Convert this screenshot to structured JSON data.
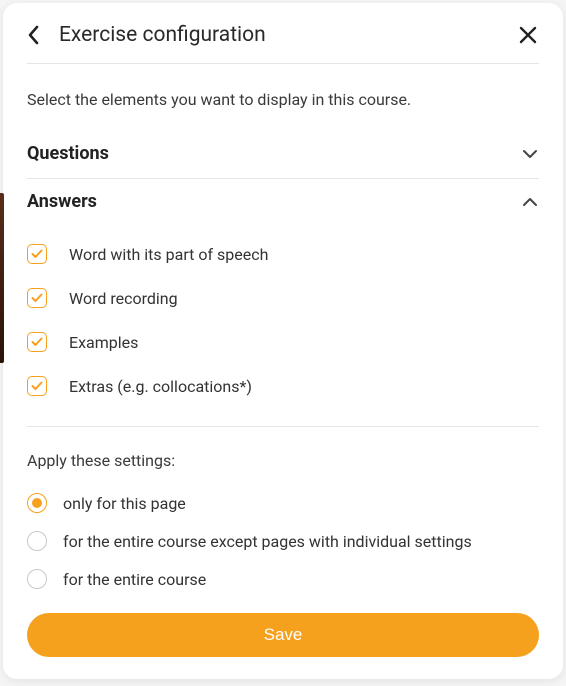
{
  "header": {
    "title": "Exercise configuration"
  },
  "intro": "Select the elements you want to display in this course.",
  "sections": {
    "questions": {
      "title": "Questions",
      "expanded": false
    },
    "answers": {
      "title": "Answers",
      "expanded": true,
      "options": [
        {
          "label": "Word with its part of speech",
          "checked": true
        },
        {
          "label": "Word recording",
          "checked": true
        },
        {
          "label": "Examples",
          "checked": true
        },
        {
          "label": "Extras (e.g. collocations*)",
          "checked": true
        }
      ]
    }
  },
  "apply": {
    "title": "Apply these settings:",
    "options": [
      {
        "label": "only for this page",
        "selected": true
      },
      {
        "label": "for the entire course except pages with individual settings",
        "selected": false
      },
      {
        "label": "for the entire course",
        "selected": false
      }
    ]
  },
  "footer": {
    "save_label": "Save"
  }
}
